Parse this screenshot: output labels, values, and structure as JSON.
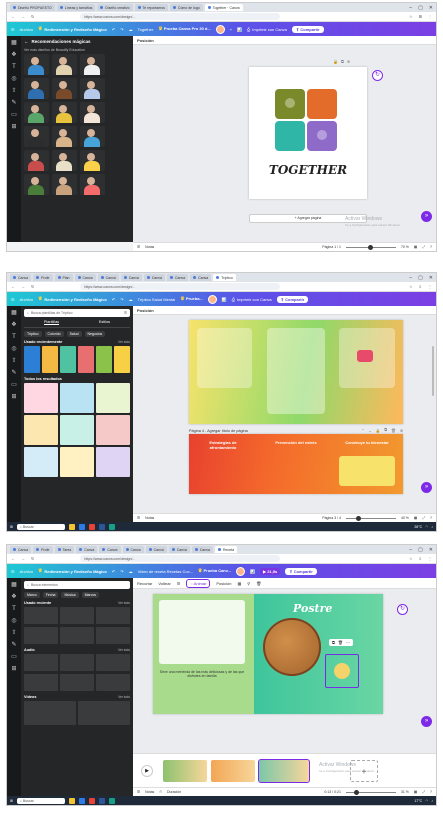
{
  "common": {
    "url": "https://www.canva.com/design/...",
    "menu_file": "Archivo",
    "resize": "Redimensión y Rediseño Mágico",
    "print_with_canva": "Imprimir con Canva",
    "share": "Compartir",
    "notes": "Notas",
    "taskbar_search": "Buscar"
  },
  "s1": {
    "tabs": [
      "Diseño PROPUESTO",
      "Líneas y tamaños",
      "Diseño creativo",
      "Te reportamos",
      "Cómo de logo",
      "Together · Canva"
    ],
    "project_title": "Together",
    "pro_trial": "Prueba Canva Pro 30 d...",
    "panel_title": "Recomendaciones mágicas",
    "panel_sub": "Ver más diseños de Beautify Education",
    "sticker_colors": [
      "#3a8ccf",
      "#e3d2b0",
      "#f0f0f0",
      "#2f6fb0",
      "#7a4b2a",
      "#b7c9e8",
      "#5aa66a",
      "#e7c33e",
      "#f3e6d8",
      "#2d2d2d",
      "#d8b48a",
      "#46a4d8",
      "#c94d4d",
      "#e9e0c8",
      "#fbd14b",
      "#4a7d3a",
      "#c7a27c",
      "#f36b6b"
    ],
    "page_label": "Posición",
    "canvas_title": "TOGETHER",
    "puzzle_colors": [
      "#7a8a2a",
      "#e36c2a",
      "#2fb6a6",
      "#8f6bc9"
    ],
    "add_page": "+ Agregar página",
    "page_count": "Página 1 / 1",
    "zoom": "70 %"
  },
  "s2": {
    "tabs": [
      "Canva",
      "Profe",
      "Plan",
      "Canva",
      "Canva",
      "Canva",
      "Canva",
      "Canva",
      "Canva",
      "Tríptico"
    ],
    "project_title": "Tríptico Salud Mental",
    "pro_trial": "Prueba...",
    "search_placeholder": "Busca plantillas de Tríptico",
    "panel_tabs": [
      "Plantillas",
      "Estilos"
    ],
    "chips": [
      "Tríptico",
      "Colorido",
      "Salud",
      "Negocios"
    ],
    "recent_heading": "Usado recientemente",
    "see_all": "Ver todo",
    "recent_colors": [
      "#2b7fd4",
      "#f4b942",
      "#4fc3a1",
      "#e86f6f",
      "#8bc34a",
      "#f7d046"
    ],
    "results_heading": "Todos los resultados",
    "result_colors": [
      "#ffd7e2",
      "#b9e3f3",
      "#e9f5d0",
      "#fde7b0",
      "#c9f0e6",
      "#f6c9c9",
      "#d4ecf7",
      "#fff1c2",
      "#e0d4f5"
    ],
    "page_label": "Posición",
    "page4_label": "Página 4 - Agregar título de página",
    "brochure_top_colors": [
      "#f4d35e",
      "#7ed957",
      "#ffb347"
    ],
    "brochure_titles": [
      "Estrategias de afrontamiento",
      "Prevención del estrés",
      "Construye tu bienestar"
    ],
    "page_count": "Página 3 / 4",
    "zoom": "40 %",
    "weather": "26°C"
  },
  "s3": {
    "tabs": [
      "Canva",
      "Profe",
      "Tarea",
      "Canva",
      "Canva",
      "Canva",
      "Canva",
      "Canva",
      "Canva",
      "Receta"
    ],
    "project_title": "Video de receta Recetas Coc...",
    "pro_trial": "Prueba Canv...",
    "time_badge": "21,5s",
    "search_placeholder": "Busca elementos",
    "panel_tabs": [
      "Marco",
      "Fecha",
      "Música",
      "Marcos"
    ],
    "recent_heading": "Usado reciente",
    "see_all": "Ver todo",
    "audio_heading": "Audio",
    "video_heading": "Vídeos",
    "toolbar": [
      "Recortar",
      "Voltear",
      "Animar",
      "Posición"
    ],
    "canvas_title": "Postre",
    "recipe_caption": "Sirve una merienda de las más deliciosas y de las que disfrutes en familia",
    "duration": "Duración",
    "time": "0:13 / 0:21",
    "zoom": "31 %",
    "clip_colors": [
      "#8dc26f",
      "#f2a654",
      "#7cc7a8"
    ],
    "weather": "17°C"
  },
  "watermark": {
    "title": "Activar Windows",
    "sub": "Ve a Configuración para activar Windows."
  }
}
